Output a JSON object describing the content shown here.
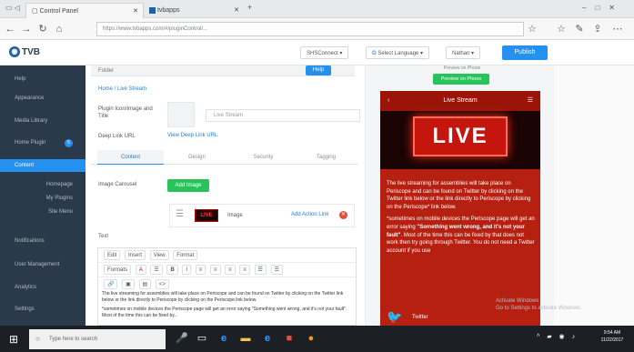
{
  "browser": {
    "tabs": [
      {
        "label": "Control Panel"
      },
      {
        "label": "tvbapps"
      }
    ],
    "url": "https://www.tvbapps.com/#/pluginControl/...",
    "new_tab_label": "+"
  },
  "header": {
    "logo_text": "TVB",
    "connect_label": "SHSConnect",
    "language_label": "Select Language",
    "user_label": "Nathan",
    "publish_label": "Publish"
  },
  "sidebar": {
    "items": [
      {
        "label": "Help"
      },
      {
        "label": "Appearance"
      },
      {
        "label": "Media Library"
      },
      {
        "label": "Home Plugin",
        "badge": "5"
      },
      {
        "label": "Content"
      },
      {
        "label": "Homepage"
      },
      {
        "label": "My Plugins"
      },
      {
        "label": "Site Menu"
      },
      {
        "label": "Notifications"
      },
      {
        "label": "User Management"
      },
      {
        "label": "Analytics"
      },
      {
        "label": "Settings"
      }
    ]
  },
  "main": {
    "folder_label": "Folder",
    "help_label": "Help",
    "breadcrumb": "Home / Live Stream",
    "plugin_label": "Plugin Icon/Image and Title",
    "title_value": "Live Stream",
    "deeplink_label": "Deep Link URL",
    "deeplink_link": "View Deep Link URL",
    "tabs": [
      {
        "label": "Content"
      },
      {
        "label": "Design"
      },
      {
        "label": "Security"
      },
      {
        "label": "Tagging"
      }
    ],
    "carousel_label": "Image Carousel",
    "add_image_label": "Add Image",
    "image_row": {
      "thumb_text": "LIVE",
      "name": "Image",
      "action_link": "Add Action Link"
    },
    "text_label": "Text",
    "toolbar1": [
      "Edit",
      "Insert",
      "View",
      "Format"
    ],
    "toolbar2": [
      "Formats",
      "A",
      "B",
      "I"
    ],
    "editor_text_1": "The live streaming for assemblies will take place on Periscope and can be found on Twitter by clicking on the Twitter link below or the link directly to Periscope by clicking on the Periscope link below.",
    "editor_text_2": "*sometimes on mobile devices the Periscope page will get an error saying \"Something went wrong, and it's not your fault\". Most of the time this can be fixed by..."
  },
  "preview": {
    "top_text": "Preview on Phone",
    "button_label": "Preview on Phone",
    "phone_title": "Live Stream",
    "live_word": "LIVE",
    "text_1": "The live streaming for assemblies will take place on Periscope and can be found on Twitter by clicking on the Twitter link below or the link directly to Periscope by clicking on the Periscope* link below.",
    "text_2a": "*sometimes on mobile devices the Periscope page will get an error saying ",
    "text_2b": "\"Something went wrong, and it's not your fault\"",
    "text_2c": ". Most of the time this can be fixed by that does not work then try going through Twitter. You do not need a Twitter account if you use",
    "twitter_label": "Twitter"
  },
  "watermark": {
    "line1": "Activate Windows",
    "line2": "Go to Settings to activate Windows."
  },
  "taskbar": {
    "search_placeholder": "Type here to search",
    "time": "9:54 AM",
    "date": "11/22/2017"
  }
}
